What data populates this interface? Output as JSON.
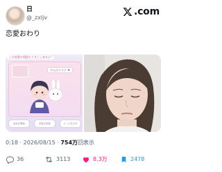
{
  "author": {
    "name": "日",
    "handle": "@_zxljv"
  },
  "brand": {
    "logo_text": ".com",
    "icon": "x-logo-icon"
  },
  "tweet": {
    "text": "恋愛おわり"
  },
  "media": {
    "left_image": {
      "top_text": "この恋愛の相談もうすこしあるよ?",
      "bubble_text": "がんばりすぎ ♥",
      "buttons": [
        "会話を開始",
        "恋愛の相談",
        "ルームを片付"
      ]
    },
    "right_image": {
      "description_icon": "photo-icon"
    }
  },
  "meta": {
    "time": "0:18",
    "separator": "·",
    "date": "2026/08/15",
    "views_count": "754万",
    "views_label": "回表示"
  },
  "stats": {
    "replies": "36",
    "retweets": "3113",
    "likes": "8.3万",
    "bookmarks": "2478"
  },
  "colors": {
    "text": "#0f1419",
    "secondary": "#536471",
    "like": "#f91880"
  }
}
